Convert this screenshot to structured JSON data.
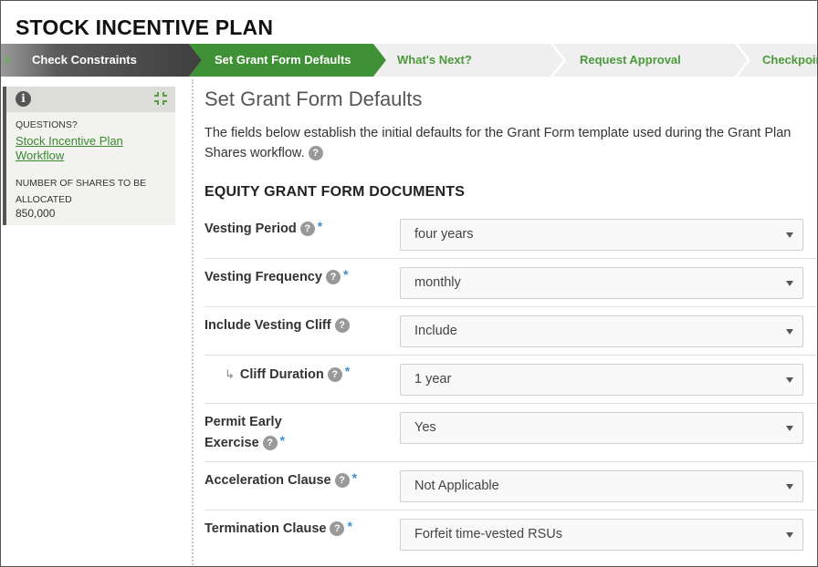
{
  "app": {
    "title": "STOCK INCENTIVE PLAN"
  },
  "steps": [
    {
      "label": "Check Constraints",
      "state": "completed"
    },
    {
      "label": "Set Grant Form Defaults",
      "state": "active"
    },
    {
      "label": "What's Next?",
      "state": "upcoming"
    },
    {
      "label": "Request Approval",
      "state": "upcoming"
    },
    {
      "label": "Checkpoint",
      "state": "upcoming"
    }
  ],
  "sidebar": {
    "questions_label": "QUESTIONS?",
    "link": "Stock Incentive Plan Workflow",
    "shares_label": "NUMBER OF SHARES TO BE ALLOCATED",
    "shares_value": "850,000",
    "icons": [
      "info-icon",
      "collapse-icon"
    ]
  },
  "main": {
    "title": "Set Grant Form Defaults",
    "intro": "The fields below establish the initial defaults for the Grant Form template used during the Grant Plan Shares workflow.",
    "section": "EQUITY GRANT FORM DOCUMENTS",
    "fields": [
      {
        "label": "Vesting Period",
        "required": true,
        "value": "four years"
      },
      {
        "label": "Vesting Frequency",
        "required": true,
        "value": "monthly"
      },
      {
        "label": "Include Vesting Cliff",
        "required": false,
        "value": "Include"
      },
      {
        "label": "Cliff Duration",
        "required": true,
        "value": "1 year"
      },
      {
        "label_line1": "Permit Early",
        "label_line2": "Exercise",
        "required": true,
        "value": "Yes"
      },
      {
        "label": "Acceleration Clause",
        "required": true,
        "value": "Not Applicable"
      },
      {
        "label": "Termination Clause",
        "required": true,
        "value": "Forfeit time-vested RSUs"
      }
    ]
  },
  "colors": {
    "accent_green": "#3f9135",
    "link_green": "#3a8a30",
    "required_blue": "#3c8fd0"
  }
}
